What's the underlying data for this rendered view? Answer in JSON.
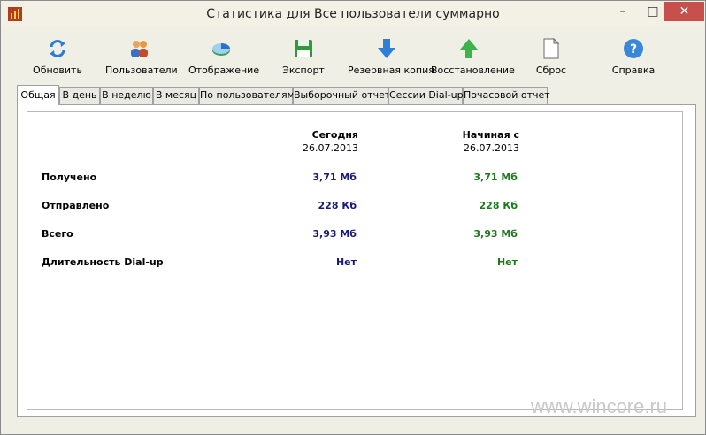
{
  "window": {
    "title": "Статистика для Все пользователи суммарно",
    "minimize": "–",
    "maximize": "□",
    "close": "✕"
  },
  "toolbar": [
    {
      "label": "Обновить",
      "icon": "refresh-icon"
    },
    {
      "label": "Пользователи",
      "icon": "users-icon"
    },
    {
      "label": "Отображение",
      "icon": "pie-chart-icon"
    },
    {
      "label": "Экспорт",
      "icon": "save-icon"
    },
    {
      "label": "Резервная копия",
      "icon": "arrow-down-icon"
    },
    {
      "label": "Восстановление",
      "icon": "arrow-up-icon"
    },
    {
      "label": "Сброс",
      "icon": "document-icon"
    },
    {
      "label": "Справка",
      "icon": "help-icon"
    }
  ],
  "tabs": [
    "Общая",
    "В день",
    "В неделю",
    "В месяц",
    "По пользователям",
    "Выборочный отчет",
    "Сессии Dial-up",
    "Почасовой отчет"
  ],
  "active_tab": "Общая",
  "stats": {
    "today_header": "Сегодня",
    "today_date": "26.07.2013",
    "since_header": "Начиная с",
    "since_date": "26.07.2013",
    "rows": [
      {
        "label": "Получено",
        "today": "3,71 Мб",
        "since": "3,71 Мб"
      },
      {
        "label": "Отправлено",
        "today": "228 Кб",
        "since": "228 Кб"
      },
      {
        "label": "Всего",
        "today": "3,93 Мб",
        "since": "3,93 Мб"
      },
      {
        "label": "Длительность Dial-up",
        "today": "Нет",
        "since": "Нет"
      }
    ]
  },
  "colors": {
    "today_value": "#1a1a7a",
    "since_value": "#1d7a1d",
    "close_button": "#c7504c"
  },
  "watermark": "www.wincore.ru"
}
